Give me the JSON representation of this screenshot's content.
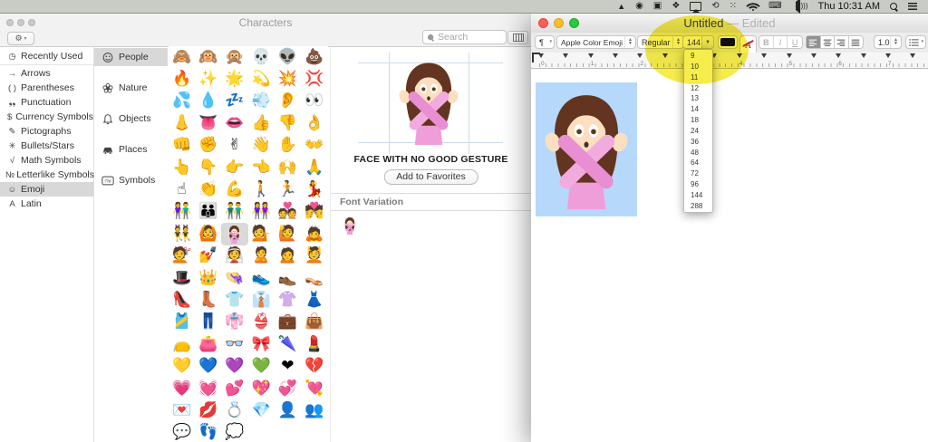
{
  "menu_bar": {
    "time": "Thu 10:31 AM"
  },
  "characters_window": {
    "title": "Characters",
    "search_placeholder": "Search",
    "sidebar": {
      "selected": "Emoji",
      "items": [
        {
          "icon": "clock-icon",
          "glyph": "◷",
          "label": "Recently Used",
          "divider_after": true
        },
        {
          "icon": "arrow-icon",
          "glyph": "→",
          "label": "Arrows"
        },
        {
          "icon": "parentheses-icon",
          "glyph": "( )",
          "label": "Parentheses"
        },
        {
          "icon": "punctuation-icon",
          "glyph": "❟❟",
          "label": "Punctuation"
        },
        {
          "icon": "currency-icon",
          "glyph": "$",
          "label": "Currency Symbols"
        },
        {
          "icon": "pictograph-icon",
          "glyph": "✎",
          "label": "Pictographs"
        },
        {
          "icon": "bullets-icon",
          "glyph": "✳",
          "label": "Bullets/Stars"
        },
        {
          "icon": "math-icon",
          "glyph": "√",
          "label": "Math Symbols"
        },
        {
          "icon": "letterlike-icon",
          "glyph": "№",
          "label": "Letterlike Symbols"
        },
        {
          "icon": "emoji-icon",
          "glyph": "☺",
          "label": "Emoji"
        },
        {
          "icon": "latin-icon",
          "glyph": "A",
          "label": "Latin"
        }
      ]
    },
    "categories": {
      "selected": "People",
      "items": [
        {
          "icon": "face-icon",
          "label": "People"
        },
        {
          "icon": "flower-icon",
          "label": "Nature"
        },
        {
          "icon": "bell-icon",
          "label": "Objects"
        },
        {
          "icon": "car-icon",
          "label": "Places"
        },
        {
          "icon": "symbols-icon",
          "label": "Symbols"
        }
      ]
    },
    "grid": {
      "selected": "🙅",
      "emoji": [
        "🙈",
        "🙉",
        "🙊",
        "💀",
        "👽",
        "💩",
        "🔥",
        "✨",
        "🌟",
        "💫",
        "💥",
        "💢",
        "💦",
        "💧",
        "💤",
        "💨",
        "👂",
        "👀",
        "👃",
        "👅",
        "👄",
        "👍",
        "👎",
        "👌",
        "👊",
        "✊",
        "✌",
        "👋",
        "✋",
        "👐",
        "👆",
        "👇",
        "👉",
        "👈",
        "🙌",
        "🙏",
        "☝",
        "👏",
        "💪",
        "🚶",
        "🏃",
        "💃",
        "👫",
        "👪",
        "👬",
        "👭",
        "💑",
        "💏",
        "👯",
        "🙆",
        "🙅",
        "💁",
        "🙋",
        "🙇",
        "💇",
        "💅",
        "👰",
        "🙎",
        "🙍",
        "💆",
        "🎩",
        "👑",
        "👒",
        "👟",
        "👞",
        "👡",
        "👠",
        "👢",
        "👕",
        "👔",
        "👚",
        "👗",
        "🎽",
        "👖",
        "👘",
        "👙",
        "💼",
        "👜",
        "👝",
        "👛",
        "👓",
        "🎀",
        "🌂",
        "💄",
        "💛",
        "💙",
        "💜",
        "💚",
        "❤",
        "💔",
        "💗",
        "💓",
        "💕",
        "💖",
        "💞",
        "💘",
        "💌",
        "💋",
        "💍",
        "💎",
        "👤",
        "👥",
        "💬",
        "👣",
        "💭"
      ]
    },
    "preview": {
      "character_name": "FACE WITH NO GOOD GESTURE",
      "add_favorites_label": "Add to Favorites",
      "section_title": "Font Variation",
      "variation_char": "🙅"
    }
  },
  "textedit_window": {
    "title": "Untitled",
    "title_suffix": " — Edited",
    "toolbar": {
      "paragraph_label": "¶",
      "font_family": "Apple Color Emoji",
      "typeface": "Regular",
      "font_size": "144",
      "bold": "B",
      "italic": "I",
      "underline": "U",
      "line_spacing": "1.0"
    },
    "ruler_numbers": [
      "0",
      "1",
      "2",
      "3",
      "4",
      "5",
      "6",
      "7"
    ],
    "size_options": [
      "9",
      "10",
      "11",
      "12",
      "13",
      "14",
      "18",
      "24",
      "36",
      "48",
      "64",
      "72",
      "96",
      "144",
      "288"
    ],
    "document_char": "🙅",
    "selection_color": "#b6d9fb",
    "highlight_color": "#f4e824"
  }
}
